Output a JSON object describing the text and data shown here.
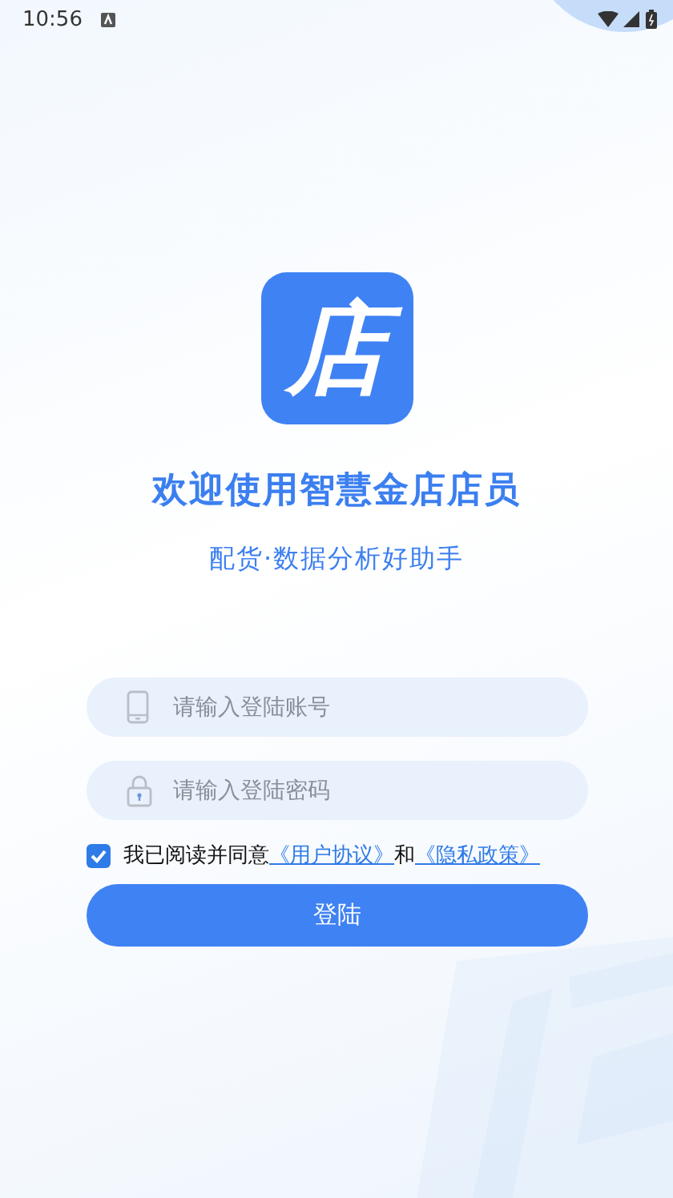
{
  "status_bar": {
    "time": "10:56"
  },
  "brand": {
    "logo_text": "店",
    "title": "欢迎使用智慧金店店员",
    "subtitle": "配货·数据分析好助手"
  },
  "fields": [
    {
      "kind": "phone",
      "placeholder": "请输入登陆账号"
    },
    {
      "kind": "lock",
      "placeholder": "请输入登陆密码"
    }
  ],
  "agreement": {
    "checked": true,
    "text": "我已阅读并同意",
    "links": [
      "《用户协议》",
      "《隐私政策》"
    ],
    "joiner": "和"
  },
  "login_button": "登陆"
}
